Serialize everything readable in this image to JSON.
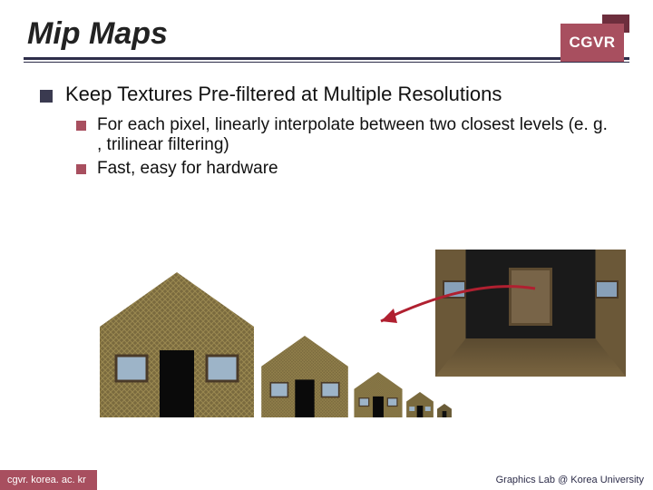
{
  "header": {
    "title": "Mip Maps",
    "badge": "CGVR"
  },
  "main": {
    "bullet": "Keep Textures Pre-filtered at Multiple Resolutions",
    "sub": [
      "For each pixel, linearly interpolate between two closest levels (e. g. , trilinear filtering)",
      "Fast, easy for hardware"
    ]
  },
  "footer": {
    "left": "cgvr. korea. ac. kr",
    "right": "Graphics Lab @ Korea University"
  },
  "colors": {
    "accent": "#a84f5f",
    "accent_dark": "#6d2e3d",
    "rule": "#2d2d4a"
  }
}
